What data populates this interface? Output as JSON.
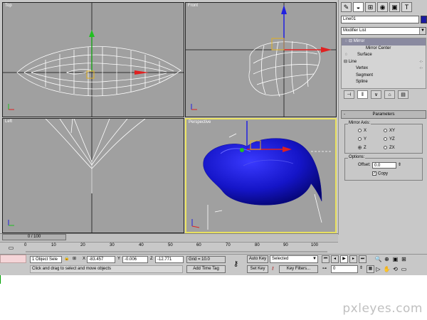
{
  "viewports": {
    "top": "Top",
    "front": "Front",
    "left": "Left",
    "perspective": "Perspective"
  },
  "command_panel": {
    "tabs": [
      {
        "icon": "create-icon",
        "glyph": "✎"
      },
      {
        "icon": "modify-icon",
        "glyph": "◒"
      },
      {
        "icon": "hierarchy-icon",
        "glyph": "⊞"
      },
      {
        "icon": "motion-icon",
        "glyph": "◉"
      },
      {
        "icon": "display-icon",
        "glyph": "▣"
      },
      {
        "icon": "utilities-icon",
        "glyph": "T"
      }
    ],
    "object_name": "Line01",
    "object_color": "#1a1aa0",
    "modifier_list": "Modifier List",
    "stack": [
      {
        "label": "Mirror",
        "prefix": "💡 ⊟",
        "selected": true
      },
      {
        "label": "Mirror Center",
        "prefix": "",
        "selected": false
      },
      {
        "label": "Surface",
        "prefix": "💡",
        "selected": false
      },
      {
        "label": "Line",
        "prefix": "⊟",
        "selected": false
      },
      {
        "label": "Vertex",
        "prefix": "",
        "selected": false
      },
      {
        "label": "Segment",
        "prefix": "",
        "selected": false
      },
      {
        "label": "Spline",
        "prefix": "",
        "selected": false
      }
    ],
    "parameters_title": "Parameters",
    "mirror_axis_title": "Mirror Axis:",
    "axes": [
      {
        "label": "X",
        "checked": false
      },
      {
        "label": "XY",
        "checked": false
      },
      {
        "label": "Y",
        "checked": false
      },
      {
        "label": "YZ",
        "checked": false
      },
      {
        "label": "Z",
        "checked": true
      },
      {
        "label": "ZX",
        "checked": false
      }
    ],
    "options_title": "Options:",
    "offset_label": "Offset:",
    "offset_value": "0.0",
    "copy_label": "Copy",
    "copy_checked": true
  },
  "timeline": {
    "slider_label": "0 / 100",
    "ticks": [
      "0",
      "10",
      "20",
      "30",
      "40",
      "50",
      "60",
      "70",
      "80",
      "90",
      "100"
    ]
  },
  "status": {
    "selection": "1 Object Sele",
    "x_label": "X",
    "x_value": "-83.457",
    "y_label": "Y",
    "y_value": "-0.006",
    "z_label": "Z",
    "z_value": "-12.771",
    "grid": "Grid = 10.0",
    "prompt": "Click and drag to select and move objects",
    "add_time_tag": "Add Time Tag",
    "auto_key": "Auto Key",
    "set_key": "Set Key",
    "key_mode": "Selected",
    "key_filters": "Key Filters...",
    "frame": "0"
  },
  "watermark": "pxleyes.com"
}
